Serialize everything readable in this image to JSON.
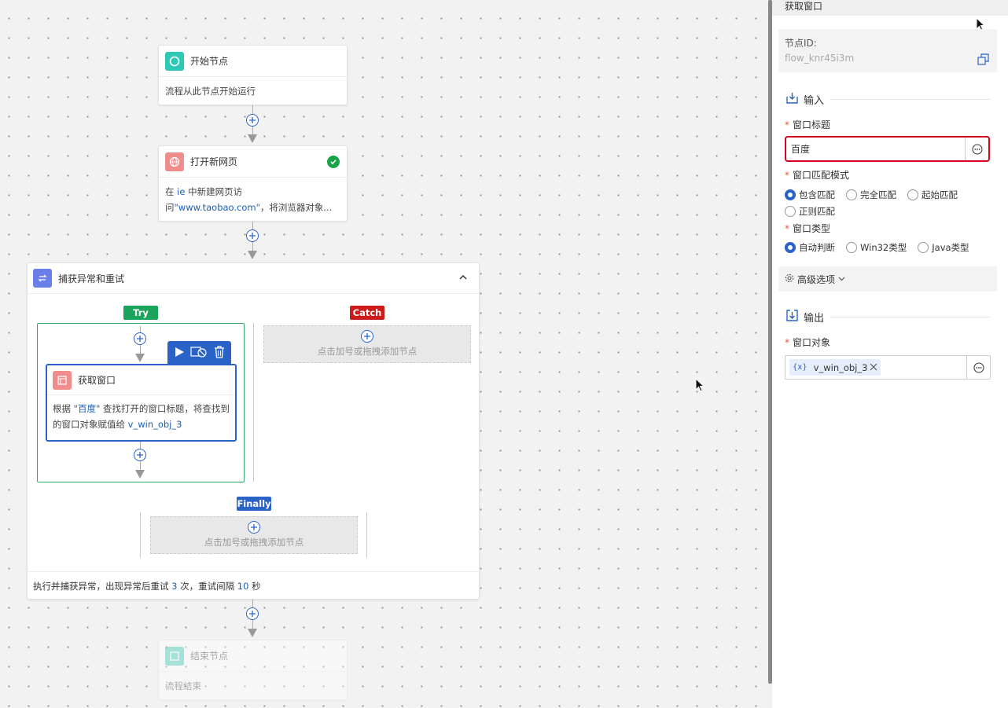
{
  "canvas": {
    "start_node": {
      "title": "开始节点",
      "desc": "流程从此节点开始运行"
    },
    "open_page_node": {
      "title": "打开新网页",
      "desc_prefix": "在 ",
      "desc_browser": "ie",
      "desc_mid": " 中新建网页访问",
      "desc_url": "\"www.taobao.com\"",
      "desc_suffix": "，将浏览器对象..."
    },
    "try_catch": {
      "title": "捕获异常和重试",
      "try_label": "Try",
      "catch_label": "Catch",
      "finally_label": "Finally",
      "drop_hint": "点击加号或拖拽添加节点",
      "footer_prefix": "执行并捕获异常，出现异常后重试 ",
      "retry_count": "3",
      "footer_mid": " 次，重试间隔 ",
      "retry_interval": "10",
      "footer_suffix": " 秒"
    },
    "get_window_node": {
      "title": "获取窗口",
      "desc_prefix": "根据 ",
      "desc_value": "\"百度\"",
      "desc_mid": " 查找打开的窗口标题，将查找到的窗口对象赋值给 ",
      "desc_var": "v_win_obj_3"
    },
    "end_node": {
      "title": "结束节点",
      "desc": "流程结束"
    }
  },
  "panel": {
    "title": "获取窗口",
    "node_id_label": "节点ID:",
    "node_id_value": "flow_knr45i3m",
    "input_section": "输入",
    "window_title_label": "窗口标题",
    "window_title_value": "百度",
    "match_mode_label": "窗口匹配模式",
    "match_modes": [
      "包含匹配",
      "完全匹配",
      "起始匹配",
      "正则匹配"
    ],
    "window_type_label": "窗口类型",
    "window_types": [
      "自动判断",
      "Win32类型",
      "Java类型"
    ],
    "advanced_label": "高级选项",
    "output_section": "输出",
    "window_object_label": "窗口对象",
    "var_prefix": "{x}",
    "window_object_value": "v_win_obj_3"
  },
  "colors": {
    "accent": "#2a63c8",
    "try": "#1aa35a",
    "catch": "#cc1b1b",
    "finally": "#2a63c8",
    "highlight": "#d9001b"
  }
}
